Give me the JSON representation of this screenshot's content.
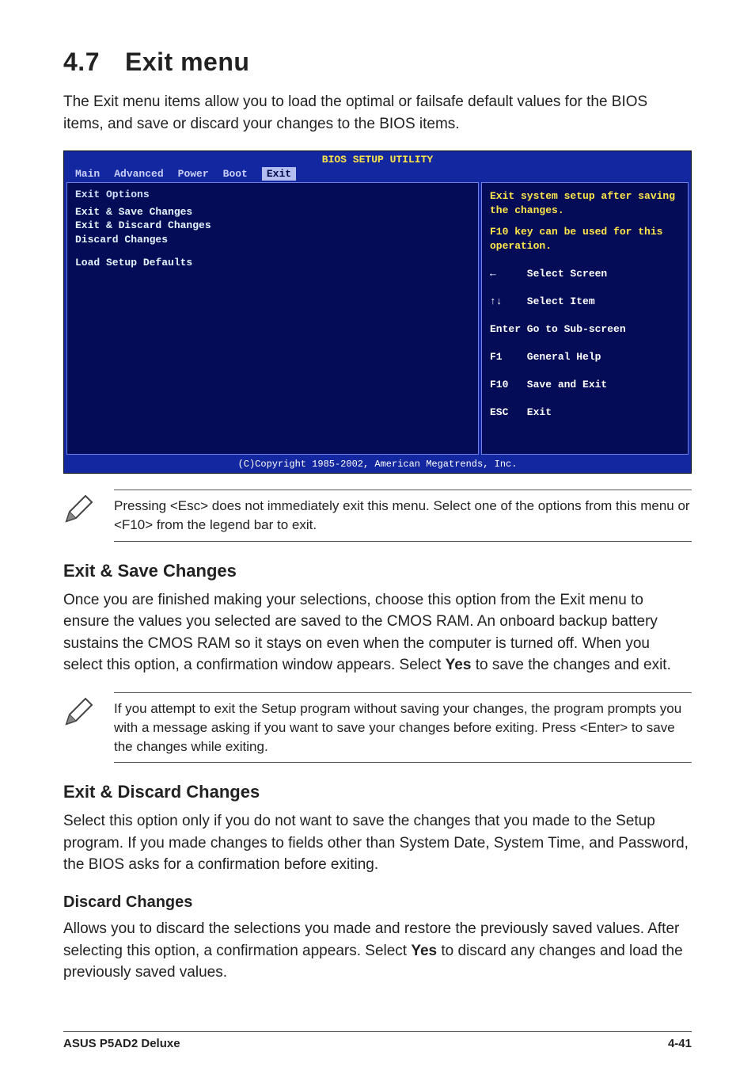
{
  "section": {
    "number": "4.7",
    "title": "Exit menu"
  },
  "intro": "The Exit menu items allow you to load the optimal or failsafe default values for the BIOS items, and save or discard your changes to the BIOS items.",
  "bios": {
    "title": "BIOS SETUP UTILITY",
    "tabs": {
      "main": "Main",
      "advanced": "Advanced",
      "power": "Power",
      "boot": "Boot",
      "exit": "Exit"
    },
    "left": {
      "header": "Exit Options",
      "items": {
        "save": "Exit & Save Changes",
        "discardexit": "Exit & Discard Changes",
        "discard": "Discard Changes",
        "defaults": "Load Setup Defaults"
      }
    },
    "help": {
      "line1": "Exit system setup after saving the changes.",
      "line2": "F10 key can be used for this operation."
    },
    "legend": {
      "selectscreen": "←     Select Screen",
      "selectitem": "↑↓    Select Item",
      "enter": "Enter Go to Sub-screen",
      "f1": "F1    General Help",
      "f10": "F10   Save and Exit",
      "esc": "ESC   Exit"
    },
    "copyright": "(C)Copyright 1985-2002, American Megatrends, Inc."
  },
  "note1": "Pressing <Esc> does not immediately exit this menu. Select one of the options from this menu or <F10> from the legend bar to exit.",
  "save": {
    "heading": "Exit & Save Changes",
    "body_a": "Once you are finished making your selections, choose this option from the Exit menu to ensure the values you selected are saved to the CMOS RAM. An onboard backup battery sustains the CMOS RAM so it stays on even when the computer is turned off. When you select this option, a confirmation window appears. Select ",
    "body_yes": "Yes",
    "body_b": " to save the changes and exit."
  },
  "note2": " If you attempt to exit the Setup program without saving your changes, the program prompts you with a message asking if you want to save your changes before exiting. Press <Enter>  to save the  changes while exiting.",
  "discardexit": {
    "heading": "Exit & Discard Changes",
    "body": "Select this option only if you do not want to save the changes that you made to the Setup program. If you made changes to fields other than System Date, System Time, and Password, the BIOS asks for a confirmation before exiting."
  },
  "discard": {
    "heading": "Discard Changes",
    "body_a": "Allows you to discard the selections you made and restore the previously saved values. After selecting this option, a confirmation appears. Select ",
    "body_yes": "Yes",
    "body_b": " to discard any changes and load the previously saved values."
  },
  "footer": {
    "left": "ASUS P5AD2 Deluxe",
    "right": "4-41"
  }
}
